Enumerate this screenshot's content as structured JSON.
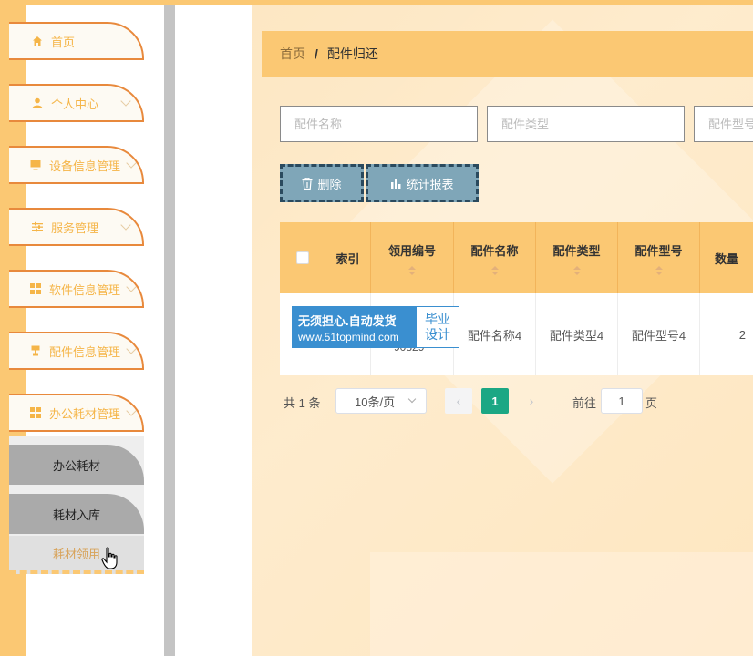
{
  "sidebar": {
    "items": [
      {
        "label": "首页",
        "icon": "home-icon"
      },
      {
        "label": "个人中心",
        "icon": "user-icon"
      },
      {
        "label": "设备信息管理",
        "icon": "monitor-icon"
      },
      {
        "label": "服务管理",
        "icon": "sliders-icon"
      },
      {
        "label": "软件信息管理",
        "icon": "grid-icon"
      },
      {
        "label": "配件信息管理",
        "icon": "trophy-icon"
      },
      {
        "label": "办公耗材管理",
        "icon": "grid-icon"
      }
    ],
    "submenu": [
      {
        "label": "办公耗材"
      },
      {
        "label": "耗材入库"
      },
      {
        "label": "耗材领用"
      }
    ]
  },
  "breadcrumb": {
    "home": "首页",
    "separator": "/",
    "current": "配件归还"
  },
  "search": {
    "field1_placeholder": "配件名称",
    "field2_placeholder": "配件类型",
    "field3_placeholder": "配件型号"
  },
  "toolbar": {
    "delete_label": "删除",
    "report_label": "统计报表"
  },
  "table": {
    "headers": [
      "索引",
      "领用编号",
      "配件名称",
      "配件类型",
      "配件型号",
      "数量"
    ],
    "rows": [
      {
        "index": "",
        "code": "90829",
        "name": "配件名称4",
        "type": "配件类型4",
        "model": "配件型号4",
        "qty": "2"
      }
    ]
  },
  "watermark": {
    "line1": "无须担心.自动发货",
    "line2": "www.51topmind.com",
    "right1": "毕业",
    "right2": "设计"
  },
  "pagination": {
    "total": "共 1 条",
    "page_size": "10条/页",
    "prev": "‹",
    "current_page": "1",
    "next": "›",
    "goto_label": "前往",
    "goto_value": "1",
    "goto_unit": "页"
  },
  "colors": {
    "accent": "#fbc873",
    "menu_border": "#e8893c",
    "toolbar_button": "#7fa6b8",
    "active_page": "#1ba784"
  }
}
